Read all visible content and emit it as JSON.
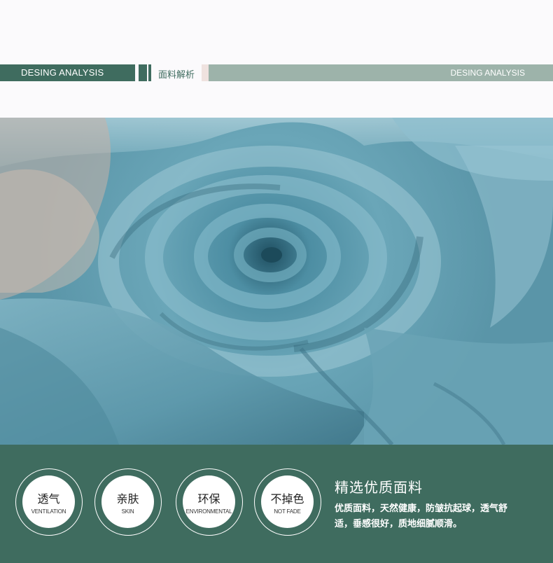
{
  "header": {
    "left_label": "DESING ANALYSIS",
    "center_label": "面料解析",
    "right_label": "DESING ANALYSIS"
  },
  "photo": {
    "subject": "fabric-swirl-image",
    "colors": {
      "base": "#5f9aab",
      "light": "#9cc4d1",
      "shadow": "#2f6072",
      "print": "#c9a99a"
    }
  },
  "features": [
    {
      "cn": "透气",
      "en": "VENTILATION",
      "icon": "ventilation-badge"
    },
    {
      "cn": "亲肤",
      "en": "SKIN",
      "icon": "skin-badge"
    },
    {
      "cn": "环保",
      "en": "ENVIRONMENTAL",
      "icon": "environmental-badge"
    },
    {
      "cn": "不掉色",
      "en": "NOT FADE",
      "icon": "not-fade-badge"
    }
  ],
  "summary": {
    "title": "精选优质面料",
    "description": "优质面料，天然健康，防皱抗起球，透气舒适，垂感很好，质地细腻顺滑。"
  },
  "colors": {
    "brand_green": "#3f6c5f",
    "sage": "#9db3aa",
    "blush": "#efe2df",
    "background": "#fbfafc"
  }
}
